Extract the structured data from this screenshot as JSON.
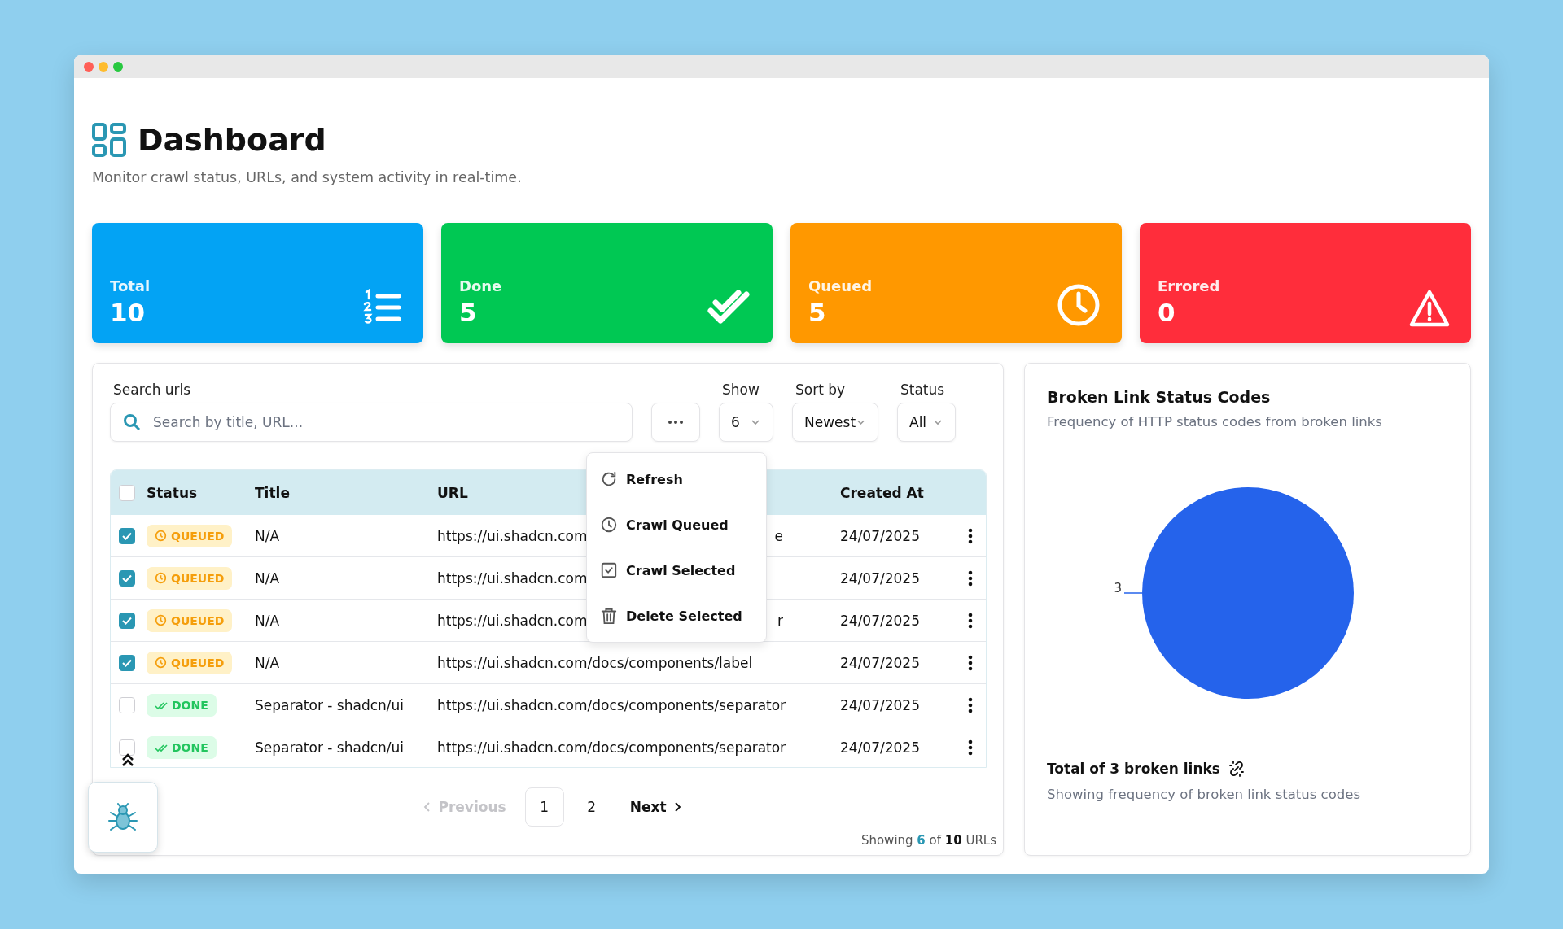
{
  "header": {
    "title": "Dashboard",
    "subtitle": "Monitor crawl status, URLs, and system activity in real-time."
  },
  "stats": [
    {
      "label": "Total",
      "value": "10",
      "color": "#03a3f4",
      "kind": "list"
    },
    {
      "label": "Done",
      "value": "5",
      "color": "#00c853",
      "kind": "check"
    },
    {
      "label": "Queued",
      "value": "5",
      "color": "#ff9800",
      "kind": "clock"
    },
    {
      "label": "Errored",
      "value": "0",
      "color": "#ff2d3b",
      "kind": "alert"
    }
  ],
  "filters": {
    "search_label": "Search urls",
    "search_placeholder": "Search by title, URL...",
    "show_label": "Show",
    "show_value": "6",
    "sort_label": "Sort by",
    "sort_value": "Newest",
    "status_label": "Status",
    "status_value": "All"
  },
  "actions_menu": [
    {
      "label": "Refresh",
      "kind": "refresh"
    },
    {
      "label": "Crawl Queued",
      "kind": "clock"
    },
    {
      "label": "Crawl Selected",
      "kind": "check"
    },
    {
      "label": "Delete Selected",
      "kind": "trash"
    }
  ],
  "table": {
    "select_all": {
      "checked": false
    },
    "columns": [
      "Status",
      "Title",
      "URL",
      "Created At"
    ],
    "rows": [
      {
        "selected": true,
        "status": "QUEUED",
        "kind": "queued",
        "title": "N/A",
        "url": "https://ui.shadcn.com",
        "url_tail": "e",
        "created": "24/07/2025"
      },
      {
        "selected": true,
        "status": "QUEUED",
        "kind": "queued",
        "title": "N/A",
        "url": "https://ui.shadcn.com",
        "created": "24/07/2025"
      },
      {
        "selected": true,
        "status": "QUEUED",
        "kind": "queued",
        "title": "N/A",
        "url": "https://ui.shadcn.com",
        "url_tail": "r",
        "created": "24/07/2025"
      },
      {
        "selected": true,
        "status": "QUEUED",
        "kind": "queued",
        "title": "N/A",
        "url": "https://ui.shadcn.com/docs/components/label",
        "created": "24/07/2025"
      },
      {
        "selected": false,
        "status": "DONE",
        "kind": "done",
        "title": "Separator - shadcn/ui",
        "url": "https://ui.shadcn.com/docs/components/separator",
        "created": "24/07/2025"
      },
      {
        "selected": false,
        "status": "DONE",
        "kind": "done",
        "title": "Separator - shadcn/ui",
        "url": "https://ui.shadcn.com/docs/components/separator",
        "created": "24/07/2025"
      }
    ]
  },
  "pagination": {
    "previous": {
      "label": "Previous",
      "disabled": true
    },
    "pages": [
      {
        "label": "1",
        "selected": true
      },
      {
        "label": "2",
        "selected": false
      }
    ],
    "next": {
      "label": "Next",
      "disabled": false
    }
  },
  "summary": "Showing **6** of **10** URLs",
  "chart_card": {
    "description": "Frequency of HTTP status codes from broken links",
    "footer_title": "Total of 3 broken links",
    "footer_text": "Showing frequency of broken link status codes",
    "chart_data": {
      "type": "pie",
      "title": "Broken Link Status Codes",
      "series": [
        {
          "color": "#2563eb",
          "values": [
            3
          ]
        }
      ],
      "data_labels": true
    }
  }
}
